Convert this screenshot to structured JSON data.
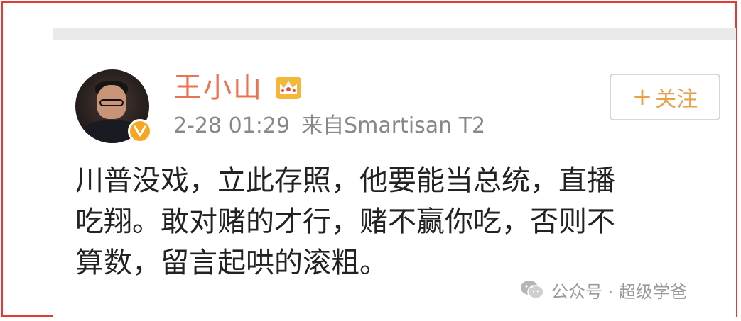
{
  "post": {
    "username": "王小山",
    "timestamp": "2-28 01:29",
    "source": "来自Smartisan T2",
    "follow_button": {
      "plus": "+",
      "label": "关注"
    },
    "content_lines": [
      "川普没戏，立此存照，他要能当总统，直播",
      "吃翔。敢对赌的才行，赌不赢你吃，否则不",
      "算数，留言起哄的滚粗。"
    ]
  },
  "watermark": {
    "text": "公众号 · 超级学爸"
  },
  "icons": {
    "crown": "crown-icon",
    "verified": "verified-badge-icon",
    "wechat": "wechat-icon"
  },
  "colors": {
    "frame": "#e53935",
    "username": "#eb7350",
    "meta": "#888888",
    "follow_text": "#e8a14a",
    "badge": "#f6a623"
  }
}
